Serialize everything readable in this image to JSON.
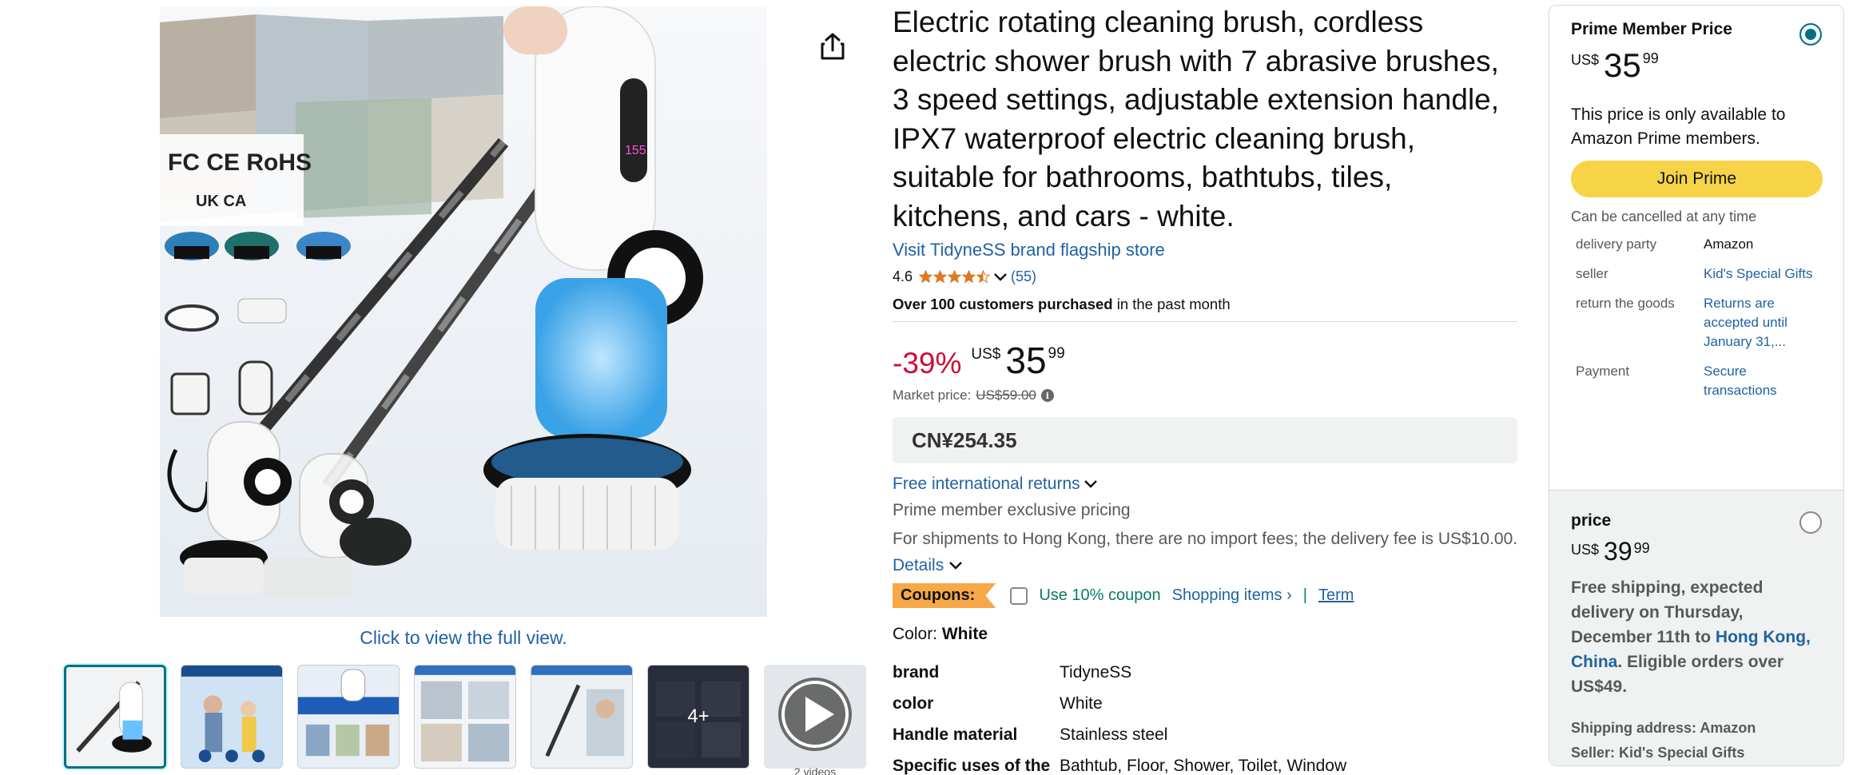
{
  "gallery": {
    "full_view_label": "Click to view the full view.",
    "main_image_alt": "Electric rotating cleaning brush with extension handles and brush heads",
    "badge_certs": "FC CE RoHS",
    "badge_ukca": "UK CA",
    "screen_reading": "155",
    "thumbs_more_label": "4+",
    "video_count": "2 videos"
  },
  "product": {
    "title": "Electric rotating cleaning brush, cordless electric shower brush with 7 abrasive brushes, 3 speed settings, adjustable extension handle, IPX7 waterproof electric cleaning brush, suitable for bathrooms, bathtubs, tiles, kitchens, and cars - white.",
    "brand_store_link": "Visit TidyneSS brand flagship store",
    "rating": "4.6",
    "rating_stars": 4.5,
    "review_count": "(55)",
    "purchased_bold": "Over 100 customers purchased",
    "purchased_rest": " in the past month"
  },
  "pricing": {
    "discount": "-39%",
    "currency": "US$",
    "whole": "35",
    "fraction": "99",
    "market_label": "Market price:",
    "market_value": "US$59.00",
    "local_price": "CN¥254.35",
    "returns_link": "Free international returns",
    "prime_pricing": "Prime member exclusive pricing",
    "shipping_note": "For shipments to Hong Kong, there are no import fees; the delivery fee is US$10.00.",
    "details_link": "Details"
  },
  "coupon": {
    "badge": "Coupons:",
    "text": "Use 10% coupon",
    "shopping_items": "Shopping items",
    "separator": "|",
    "term": "Term"
  },
  "color": {
    "label": "Color: ",
    "value": "White"
  },
  "specs": [
    {
      "key": "brand",
      "value": "TidyneSS"
    },
    {
      "key": "color",
      "value": "White"
    },
    {
      "key": "Handle material",
      "value": "Stainless steel"
    },
    {
      "key": "Specific uses of the",
      "value": "Bathtub, Floor, Shower, Toilet, Window"
    }
  ],
  "buybox": {
    "prime": {
      "title": "Prime Member Price",
      "currency": "US$",
      "whole": "35",
      "fraction": "99",
      "only_text": "This price is only available to Amazon Prime members.",
      "join_label": "Join Prime",
      "cancel_text": "Can be cancelled at any time",
      "rows": [
        {
          "key": "delivery party",
          "value": "Amazon"
        },
        {
          "key": "seller",
          "value": "Kid's Special Gifts"
        },
        {
          "key": "return the goods",
          "value": "Returns are accepted until January 31,..."
        },
        {
          "key": "Payment",
          "value": "Secure transactions"
        }
      ]
    },
    "regular": {
      "title": "price",
      "currency": "US$",
      "whole": "39",
      "fraction": "99",
      "delivery_a": "Free shipping, expected delivery on Thursday, December 11th to ",
      "delivery_link": "Hong Kong, China",
      "delivery_b": ". Eligible orders over US$49.",
      "ship_address": "Shipping address: Amazon",
      "seller": "Seller: Kid's Special Gifts"
    }
  },
  "colors": {
    "link": "#2162a1",
    "deal_red": "#cc0c39",
    "star": "#de7921",
    "join_button": "#f7d447",
    "coupon_badge": "#f7a847",
    "coupon_green": "#067d62",
    "selected_thumb": "#007185"
  }
}
